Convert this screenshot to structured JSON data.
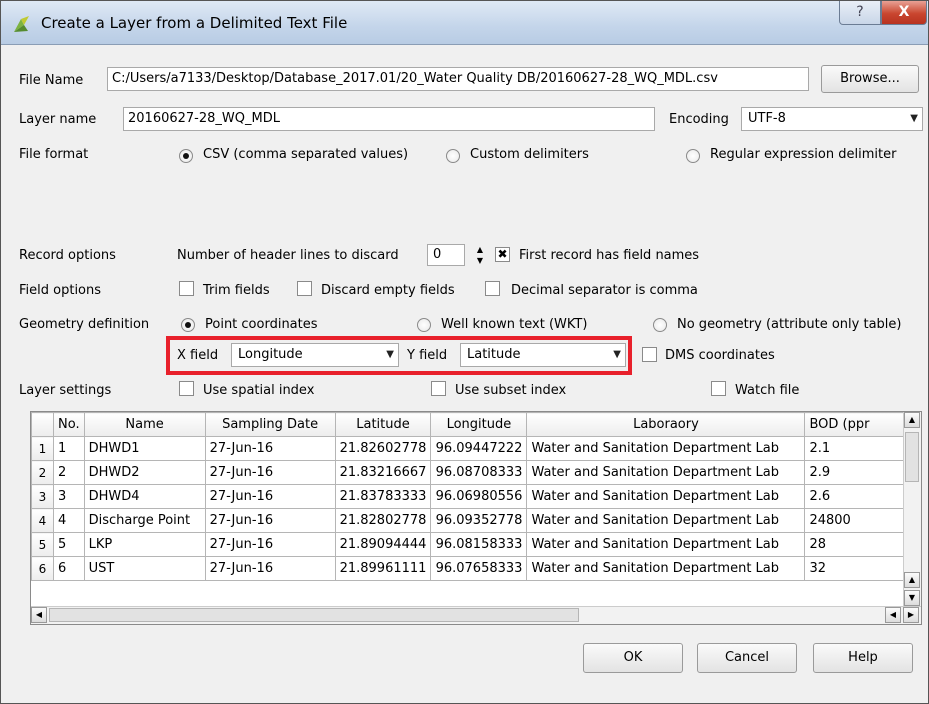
{
  "window": {
    "title": "Create a Layer from a Delimited Text File",
    "help_glyph": "?",
    "close_glyph": "X"
  },
  "file": {
    "label": "File Name",
    "path": "C:/Users/a7133/Desktop/Database_2017.01/20_Water Quality DB/20160627-28_WQ_MDL.csv",
    "browse": "Browse..."
  },
  "layer": {
    "label": "Layer name",
    "value": "20160627-28_WQ_MDL",
    "encoding_label": "Encoding",
    "encoding_value": "UTF-8"
  },
  "file_format": {
    "label": "File format",
    "options": [
      "CSV (comma separated values)",
      "Custom delimiters",
      "Regular expression delimiter"
    ],
    "selected": 0
  },
  "record_options": {
    "label": "Record options",
    "header_lines_label": "Number of header lines to discard",
    "header_lines_value": "0",
    "first_record_label": "First record has field names",
    "first_record_checked": true
  },
  "field_options": {
    "label": "Field options",
    "trim": "Trim fields",
    "discard_empty": "Discard empty fields",
    "decimal_comma": "Decimal separator is comma"
  },
  "geometry": {
    "label": "Geometry definition",
    "options": [
      "Point coordinates",
      "Well known text (WKT)",
      "No geometry (attribute only table)"
    ],
    "selected": 0,
    "x_label": "X field",
    "x_value": "Longitude",
    "y_label": "Y field",
    "y_value": "Latitude",
    "dms": "DMS coordinates"
  },
  "layer_settings": {
    "label": "Layer settings",
    "spatial_index": "Use spatial index",
    "subset_index": "Use subset index",
    "watch_file": "Watch file"
  },
  "table": {
    "headers": [
      "No.",
      "Name",
      "Sampling Date",
      "Latitude",
      "Longitude",
      "Laboraory",
      "BOD (ppr"
    ],
    "rows": [
      [
        "1",
        "1",
        "DHWD1",
        "27-Jun-16",
        "21.82602778",
        "96.09447222",
        "Water and Sanitation Department Lab",
        "2.1"
      ],
      [
        "2",
        "2",
        "DHWD2",
        "27-Jun-16",
        "21.83216667",
        "96.08708333",
        "Water and Sanitation Department Lab",
        "2.9"
      ],
      [
        "3",
        "3",
        "DHWD4",
        "27-Jun-16",
        "21.83783333",
        "96.06980556",
        "Water and Sanitation Department Lab",
        "2.6"
      ],
      [
        "4",
        "4",
        "Discharge Point",
        "27-Jun-16",
        "21.82802778",
        "96.09352778",
        "Water and Sanitation Department Lab",
        "24800"
      ],
      [
        "5",
        "5",
        "LKP",
        "27-Jun-16",
        "21.89094444",
        "96.08158333",
        "Water and Sanitation Department Lab",
        "28"
      ],
      [
        "6",
        "6",
        "UST",
        "27-Jun-16",
        "21.89961111",
        "96.07658333",
        "Water and Sanitation Department Lab",
        "32"
      ]
    ]
  },
  "buttons": {
    "ok": "OK",
    "cancel": "Cancel",
    "help": "Help"
  }
}
